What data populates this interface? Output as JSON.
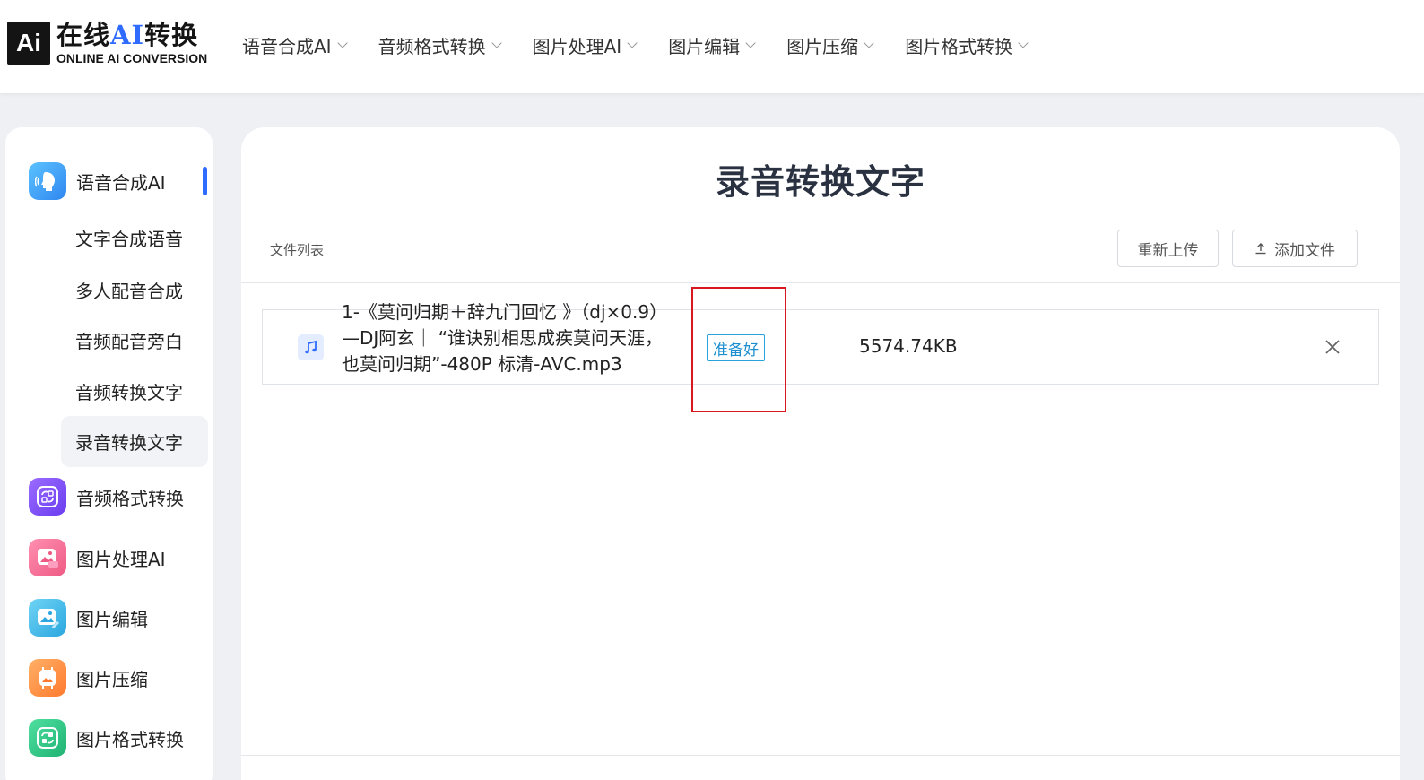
{
  "header": {
    "logo_mark": "Ai",
    "logo_cn_prefix": "在线",
    "logo_cn_ai": "AI",
    "logo_cn_suffix": "转换",
    "logo_en": "ONLINE AI CONVERSION",
    "nav": [
      {
        "label": "语音合成AI"
      },
      {
        "label": "音频格式转换"
      },
      {
        "label": "图片处理AI"
      },
      {
        "label": "图片编辑"
      },
      {
        "label": "图片压缩"
      },
      {
        "label": "图片格式转换"
      }
    ]
  },
  "sidebar": {
    "sections": [
      {
        "label": "语音合成AI",
        "icon": "voice-synthesis-icon",
        "color": "#3aa0f5"
      },
      {
        "label": "音频格式转换",
        "icon": "audio-convert-icon",
        "color": "#7c4dff"
      },
      {
        "label": "图片处理AI",
        "icon": "image-ai-icon",
        "color": "#f0648c"
      },
      {
        "label": "图片编辑",
        "icon": "image-edit-icon",
        "color": "#36b7e6"
      },
      {
        "label": "图片压缩",
        "icon": "image-compress-icon",
        "color": "#ff8a3d"
      },
      {
        "label": "图片格式转换",
        "icon": "image-convert-icon",
        "color": "#26c281"
      }
    ],
    "sub_items": [
      {
        "label": "文字合成语音"
      },
      {
        "label": "多人配音合成"
      },
      {
        "label": "音频配音旁白"
      },
      {
        "label": "音频转换文字"
      },
      {
        "label": "录音转换文字"
      }
    ],
    "accent": "#2f6bff"
  },
  "main": {
    "title": "录音转换文字",
    "file_list_label": "文件列表",
    "reupload_label": "重新上传",
    "add_file_label": "添加文件",
    "files": [
      {
        "name": "1-《莫问归期＋辞九门回忆 》（dj×0.9）—DJ阿玄｜ “谁诀别相思成疾莫问天涯，也莫问归期”-480P 标清-AVC.mp3",
        "status": "准备好",
        "size": "5574.74KB",
        "icon": "music-note-icon"
      }
    ]
  }
}
